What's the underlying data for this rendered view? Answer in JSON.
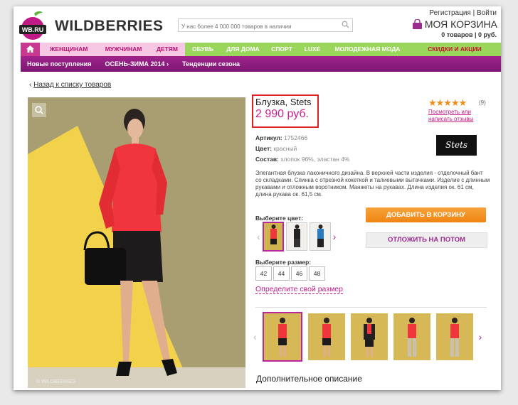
{
  "header": {
    "brand": "WILDBERRIES",
    "logo_text": "WB.RU",
    "search_placeholder": "У нас более 4 000 000 товаров в наличии",
    "register": "Регистрация",
    "separator": "|",
    "login": "Войти",
    "cart_label": "МОЯ КОРЗИНА",
    "cart_summary": "0 товаров | 0 руб."
  },
  "nav": {
    "tabs": [
      "ЖЕНЩИНАМ",
      "МУЖЧИНАМ",
      "ДЕТЯМ",
      "ОБУВЬ",
      "ДЛЯ ДОМА",
      "СПОРТ",
      "LUXE",
      "МОЛОДЕЖНАЯ МОДА",
      "СКИДКИ И АКЦИИ"
    ],
    "sub": [
      "Новые поступления",
      "ОСЕНЬ-ЗИМА 2014",
      "Тенденции сезона"
    ],
    "sub_arrow": "›"
  },
  "back_link": "Назад к списку товаров",
  "back_arrow": "‹",
  "photo_copyright": "© WILDBERRIES",
  "product": {
    "title": "Блузка, Stets",
    "price": "2 990 руб.",
    "stars": "★★★★★",
    "review_count": "(9)",
    "reviews_link": "Посмотреть или написать отзывы",
    "brand_logo": "Stets",
    "article_label": "Артикул:",
    "article": "1752466",
    "color_label": "Цвет:",
    "color": "красный",
    "composition_label": "Состав:",
    "composition": "хлопок 96%, эластан 4%",
    "description": "Элегантная блузка лаконичного дизайна. В верхней части изделия - отделочный бант со складками. Спинка с отрезной кокеткой и талиевыми вытачками. Изделие с длинным рукавами и отложным воротником. Манжеты на рукавах. Длина изделия ок. 61 см, длина рукава ок. 61,5 см."
  },
  "choose_color": "Выберите цвет:",
  "add_to_cart": "ДОБАВИТЬ В КОРЗИНУ",
  "save_later": "ОТЛОЖИТЬ НА ПОТОМ",
  "choose_size": "Выберите размер:",
  "sizes": [
    "42",
    "44",
    "46",
    "48"
  ],
  "size_help": "Определите свой размер",
  "arrow_left": "‹",
  "arrow_right": "›",
  "more_description": "Дополнительное описание",
  "colors": {
    "accent": "#c01a86",
    "nav_purple": "#8b1a7e",
    "cart_orange": "#ef8511",
    "nav_green": "#9ad65b"
  }
}
